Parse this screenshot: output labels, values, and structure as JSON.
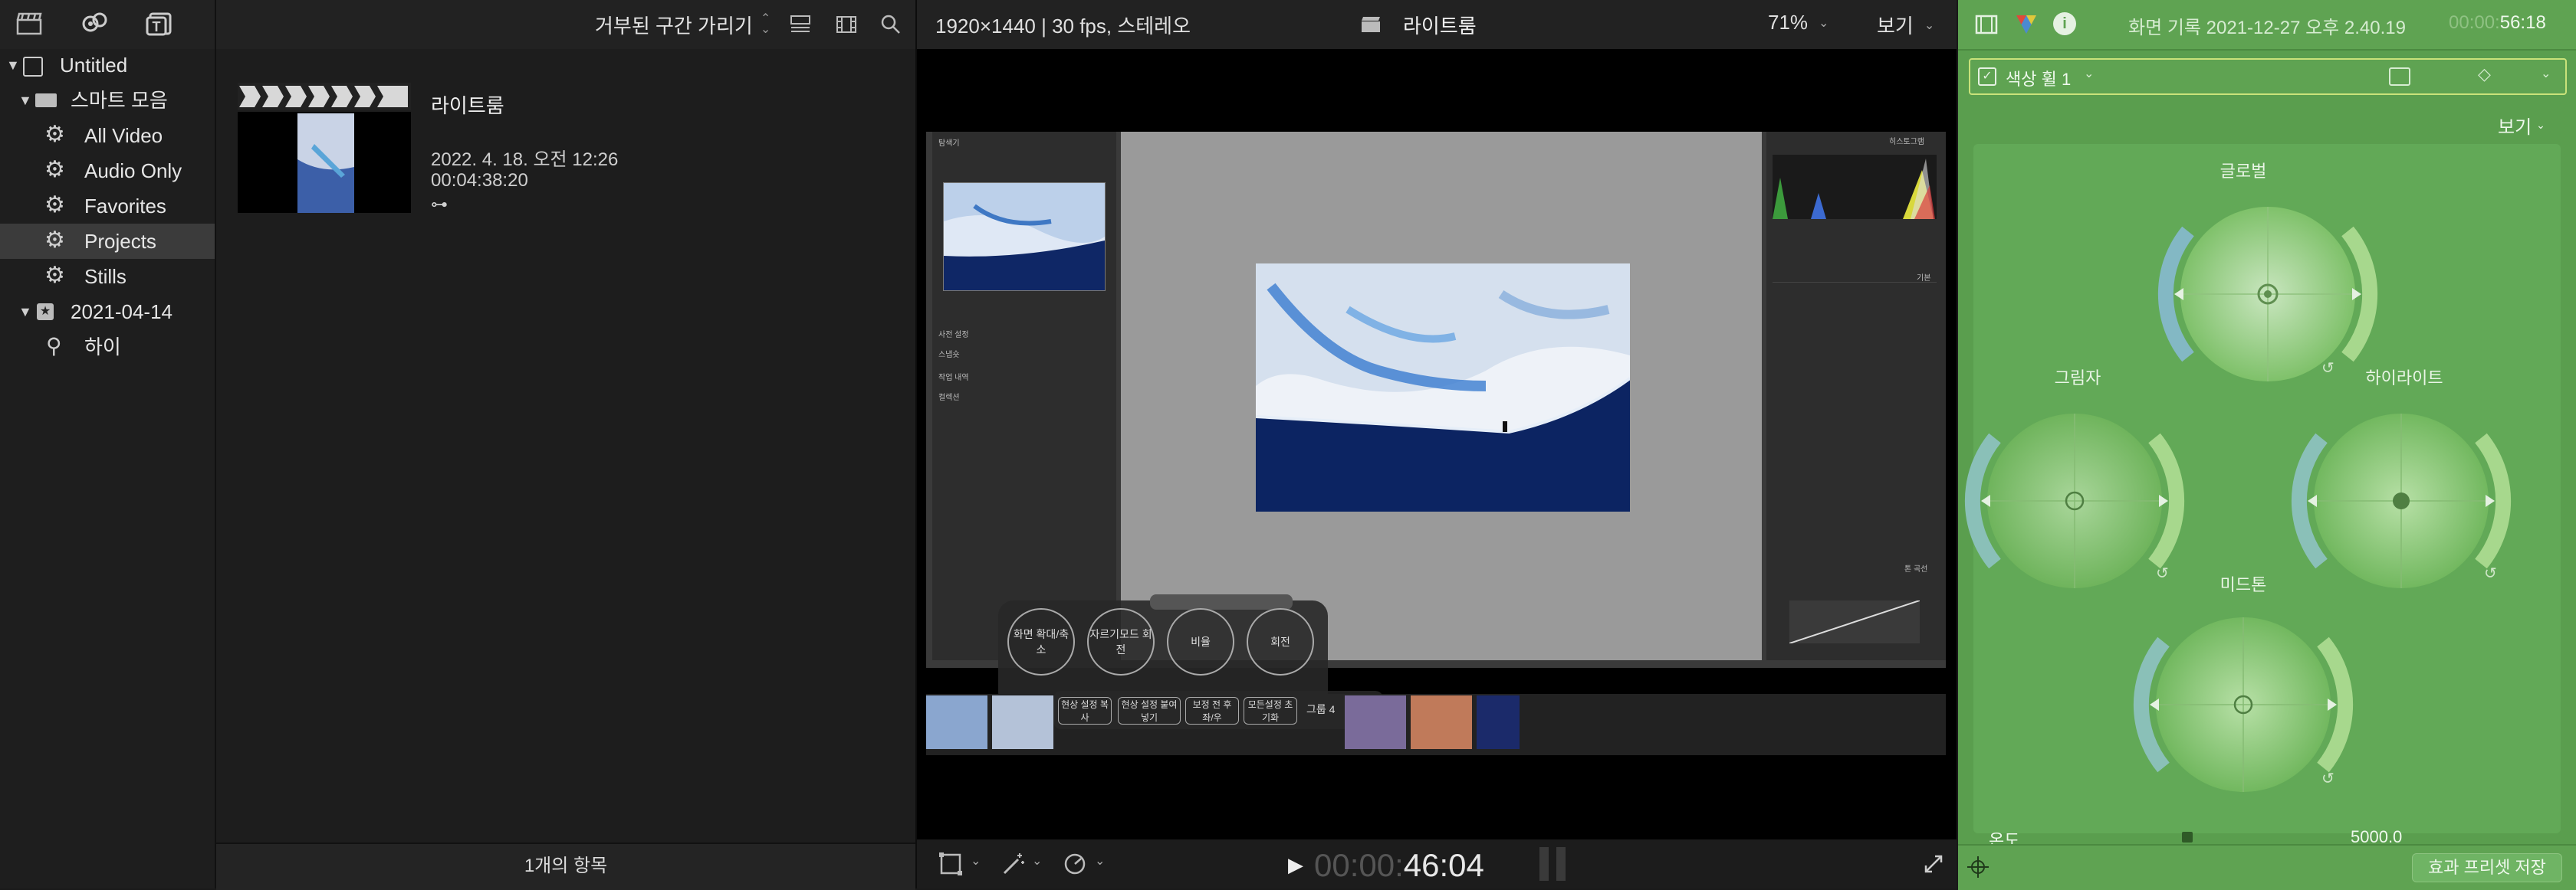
{
  "sidebar": {
    "toolbar_icons": [
      "clapper-icon",
      "music-icon",
      "title-icon"
    ],
    "items": [
      {
        "label": "Untitled",
        "level": 0,
        "icon": "library-icon",
        "expanded": true
      },
      {
        "label": "스마트 모음",
        "level": 1,
        "icon": "folder-icon",
        "expanded": true
      },
      {
        "label": "All Video",
        "level": 2,
        "icon": "gear-icon"
      },
      {
        "label": "Audio Only",
        "level": 2,
        "icon": "gear-icon"
      },
      {
        "label": "Favorites",
        "level": 2,
        "icon": "gear-icon"
      },
      {
        "label": "Projects",
        "level": 2,
        "icon": "gear-icon",
        "selected": true
      },
      {
        "label": "Stills",
        "level": 2,
        "icon": "gear-icon"
      },
      {
        "label": "2021-04-14",
        "level": 0,
        "icon": "event-icon",
        "expanded": true
      },
      {
        "label": "하이",
        "level": 2,
        "icon": "keyword-icon"
      }
    ]
  },
  "browser": {
    "filter_label": "거부된 구간 가리기",
    "project": {
      "title": "라이트룸",
      "date": "2022. 4. 18. 오전 12:26",
      "duration": "00:04:38:20"
    },
    "footer": "1개의 항목"
  },
  "viewer": {
    "format": "1920×1440 | 30 fps, 스테레오",
    "title": "라이트룸",
    "zoom": "71%",
    "view_label": "보기",
    "timecode_dim": "00:00:",
    "timecode": "46:04",
    "inner_app": {
      "navigator_label": "탐색기",
      "histogram_label": "히스토그램",
      "basic_label": "기본",
      "tone_curve_label": "톤 곡선",
      "left_sections": [
        "사전 설정",
        "스냅숏",
        "작업 내역",
        "컬렉션"
      ],
      "overlay_buttons": [
        "화면 확대/축소",
        "자르기모드 회전",
        "비율",
        "회전"
      ],
      "overlay_buttons_row2": [
        "현상 설정 복사",
        "현상 설정 붙여넣기",
        "보정 전 후 좌/우",
        "모든설정 초기화"
      ],
      "overlay_group": "그룹 4"
    }
  },
  "inspector": {
    "title": "화면 기록 2021-12-27 오후 2.40.19",
    "duration_dim": "00:00:",
    "duration": "56:18",
    "effect_label": "색상 휠 1",
    "view_label": "보기",
    "wheels": [
      "글로벌",
      "그림자",
      "하이라이트",
      "미드톤"
    ],
    "temperature_label": "온도",
    "temperature_value": "5000.0",
    "save_preset": "효과 프리셋 저장"
  },
  "colors": {
    "inspector_green": "#5a9e4e",
    "selection_gray": "#3b3b3b",
    "toolbar_bg": "#222222"
  }
}
